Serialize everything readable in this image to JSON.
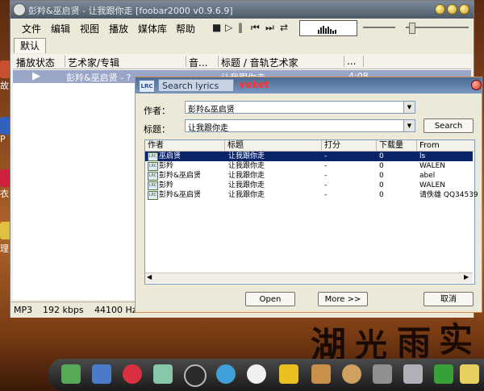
{
  "window": {
    "title": "彭羚&巫启贤 - 让我跟你走    [foobar2000 v0.9.6.9]"
  },
  "menu": [
    "文件",
    "编辑",
    "视图",
    "播放",
    "媒体库",
    "帮助"
  ],
  "toolbar": {
    "buttons": [
      "stop-icon",
      "play-icon",
      "pause-icon",
      "previous-icon",
      "next-icon",
      "random-icon"
    ]
  },
  "tabs": {
    "default": "默认"
  },
  "playlist": {
    "columns": [
      "播放状态",
      "艺术家/专辑",
      "音...",
      "标题 / 音轨艺术家",
      "..."
    ],
    "rows": [
      {
        "artist": "彭羚&巫启贤 - ?",
        "title": "让我跟你走",
        "duration": "4:08"
      }
    ]
  },
  "status": {
    "codec": "MP3",
    "bitrate": "192 kbps",
    "samplerate": "44100 Hz"
  },
  "dialog": {
    "tab_label": "Search lyrics",
    "brand": "veket",
    "lrc_badge": "LRC",
    "artist_label": "作者：",
    "artist_value": "彭羚&巫启贤",
    "title_label": "标题：",
    "title_value": "让我跟你走",
    "search_button": "Search",
    "columns": [
      "作者",
      "标题",
      "打分",
      "下载量",
      "From"
    ],
    "results": [
      {
        "artist": "巫启贤",
        "title": "让我跟你走",
        "score": "-",
        "downloads": "0",
        "from": "ls"
      },
      {
        "artist": "彭羚",
        "title": "让我跟你走",
        "score": "-",
        "downloads": "0",
        "from": "WALEN"
      },
      {
        "artist": "彭羚&巫启贤",
        "title": "让我跟你走",
        "score": "-",
        "downloads": "0",
        "from": "abel"
      },
      {
        "artist": "彭羚",
        "title": "让我跟你走",
        "score": "-",
        "downloads": "0",
        "from": "WALEN"
      },
      {
        "artist": "彭羚&巫启贤",
        "title": "让我跟你走",
        "score": "-",
        "downloads": "0",
        "from": "请佚雄 QQ34539"
      }
    ],
    "open_button": "Open",
    "more_button": "More >>",
    "cancel_button": "取消"
  },
  "desktop": {
    "left_edge_labels": [
      "故",
      "P",
      "衣",
      "理"
    ],
    "wallpaper_text": [
      "湖",
      "光",
      "雨",
      "实"
    ]
  },
  "taskbar": {
    "icons": [
      "notepad-icon",
      "monitor-icon",
      "pig-icon",
      "paper-icon",
      "eye-icon",
      "people-icon",
      "penguin-icon",
      "folder-icon",
      "image-icon",
      "palette-icon",
      "drive-icon",
      "usb-icon",
      "tree-icon",
      "lamp-icon"
    ]
  },
  "colors": {
    "selection": "#0a246a",
    "playlist_highlight": "#9aa6c8",
    "brand": "#ff3030"
  }
}
